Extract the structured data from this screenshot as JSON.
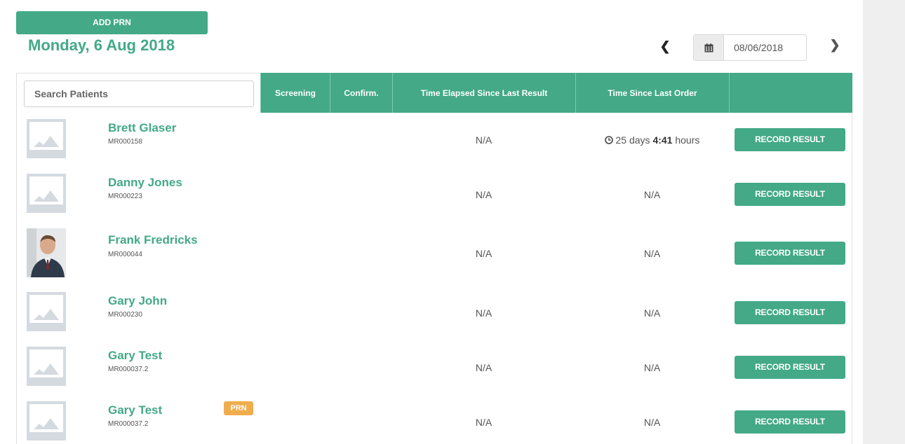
{
  "header": {
    "add_prn_label": "ADD PRN",
    "date_title": "Monday, 6 Aug 2018",
    "date_value": "08/06/2018"
  },
  "search": {
    "placeholder": "Search Patients"
  },
  "columns": {
    "screening": "Screening",
    "confirm": "Confirm.",
    "elapsed": "Time Elapsed Since Last Result",
    "since_order": "Time Since Last Order"
  },
  "record_label": "RECORD RESULT",
  "patients": [
    {
      "name": "Brett Glaser",
      "mr": "MR000158",
      "elapsed": "N/A",
      "since_days": "25 days",
      "since_time": "4:41",
      "since_unit": "hours",
      "photo": "placeholder"
    },
    {
      "name": "Danny Jones",
      "mr": "MR000223",
      "elapsed": "N/A",
      "since": "N/A",
      "photo": "placeholder"
    },
    {
      "name": "Frank Fredricks",
      "mr": "MR000044",
      "elapsed": "N/A",
      "since": "N/A",
      "photo": "person"
    },
    {
      "name": "Gary John",
      "mr": "MR000230",
      "elapsed": "N/A",
      "since": "N/A",
      "photo": "placeholder"
    },
    {
      "name": "Gary Test",
      "mr": "MR000037.2",
      "elapsed": "N/A",
      "since": "N/A",
      "photo": "placeholder"
    },
    {
      "name": "Gary Test",
      "mr": "MR000037.2",
      "elapsed": "N/A",
      "since": "N/A",
      "photo": "placeholder",
      "badge": "PRN"
    }
  ],
  "colors": {
    "accent": "#43a987",
    "badge": "#f0ad4e"
  },
  "icons": {
    "calendar": "calendar-icon",
    "clock": "clock-icon",
    "prev": "chevron-left-icon",
    "next": "chevron-right-icon"
  }
}
